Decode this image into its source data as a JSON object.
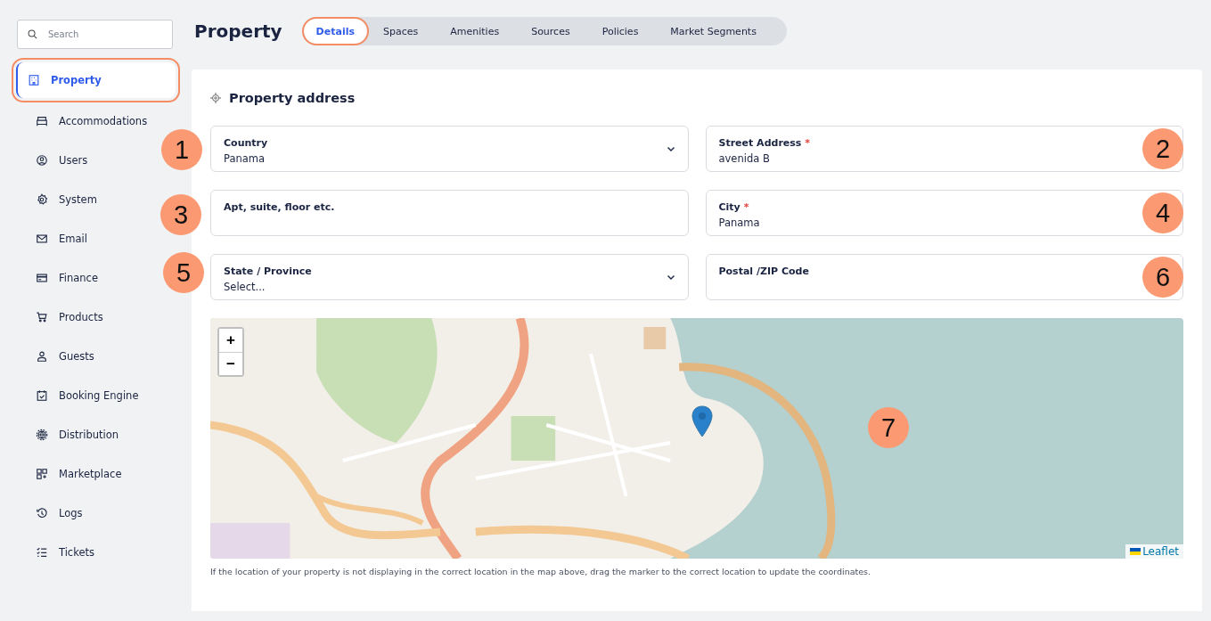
{
  "sidebar": {
    "search": {
      "placeholder": "Search"
    },
    "items": [
      {
        "label": "Property",
        "selected": true,
        "highlighted": true
      },
      {
        "label": "Accommodations",
        "selected": false,
        "highlighted": false
      },
      {
        "label": "Users",
        "selected": false,
        "highlighted": false
      },
      {
        "label": "System",
        "selected": false,
        "highlighted": false
      },
      {
        "label": "Email",
        "selected": false,
        "highlighted": false
      },
      {
        "label": "Finance",
        "selected": false,
        "highlighted": false
      },
      {
        "label": "Products",
        "selected": false,
        "highlighted": false
      },
      {
        "label": "Guests",
        "selected": false,
        "highlighted": false
      },
      {
        "label": "Booking Engine",
        "selected": false,
        "highlighted": false
      },
      {
        "label": "Distribution",
        "selected": false,
        "highlighted": false
      },
      {
        "label": "Marketplace",
        "selected": false,
        "highlighted": false
      },
      {
        "label": "Logs",
        "selected": false,
        "highlighted": false
      },
      {
        "label": "Tickets",
        "selected": false,
        "highlighted": false
      }
    ]
  },
  "page": {
    "title": "Property",
    "tabs": [
      {
        "label": "Details",
        "selected": true,
        "highlighted": true
      },
      {
        "label": "Spaces",
        "selected": false,
        "highlighted": false
      },
      {
        "label": "Amenities",
        "selected": false,
        "highlighted": false
      },
      {
        "label": "Sources",
        "selected": false,
        "highlighted": false
      },
      {
        "label": "Policies",
        "selected": false,
        "highlighted": false
      },
      {
        "label": "Market Segments",
        "selected": false,
        "highlighted": false
      }
    ]
  },
  "section": {
    "title": "Property address",
    "fields": [
      {
        "kind": "select",
        "label": "Country",
        "value": "Panama"
      },
      {
        "kind": "text",
        "label": "Street Address",
        "required_mark": "*",
        "value": "avenida B"
      },
      {
        "kind": "text",
        "label": "Apt, suite, floor etc."
      },
      {
        "kind": "text",
        "label": "City",
        "required_mark": "*",
        "value": "Panama"
      },
      {
        "kind": "select",
        "label": "State / Province",
        "placeholder": "Select..."
      },
      {
        "kind": "text",
        "label": "Postal /ZIP Code"
      }
    ],
    "map": {
      "kind": "picture",
      "zoom_in": "+",
      "zoom_out": "−",
      "attribution": "Leaflet"
    },
    "caption": "If the location of your property is not displaying in the correct location in the map above, drag the marker to the correct location to update the coordinates."
  },
  "annotations": [
    {
      "number": "1"
    },
    {
      "number": "2"
    },
    {
      "number": "3"
    },
    {
      "number": "4"
    },
    {
      "number": "5"
    },
    {
      "number": "6"
    },
    {
      "number": "7"
    }
  ]
}
